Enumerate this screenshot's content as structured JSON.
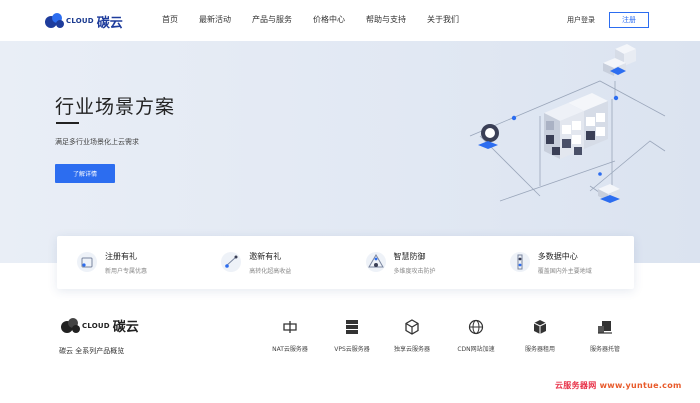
{
  "brand": {
    "logo_en": "CLOUD",
    "logo_cn": "碳云",
    "accent": "#2c6df0",
    "dark": "#1e3c9c"
  },
  "nav": {
    "links": [
      "首页",
      "最新活动",
      "产品与服务",
      "价格中心",
      "帮助与支持",
      "关于我们"
    ],
    "login": "用户登录",
    "register": "注册"
  },
  "hero": {
    "title": "行业场景方案",
    "subtitle": "满足多行业场景化上云需求",
    "button": "了解详情"
  },
  "features": [
    {
      "icon": "gift-icon",
      "title": "注册有礼",
      "desc": "新用户专属优惠"
    },
    {
      "icon": "invite-icon",
      "title": "邀新有礼",
      "desc": "高转化超高收益"
    },
    {
      "icon": "shield-icon",
      "title": "智慧防御",
      "desc": "多维度攻击防护"
    },
    {
      "icon": "datacenter-icon",
      "title": "多数据中心",
      "desc": "覆盖国内外主要地域"
    }
  ],
  "bottom": {
    "caption": "碳云 全系列产品概览",
    "products": [
      {
        "icon": "nat-icon",
        "label": "NAT云服务器"
      },
      {
        "icon": "server-stack-icon",
        "label": "VPS云服务器"
      },
      {
        "icon": "cube-icon",
        "label": "独享云服务器"
      },
      {
        "icon": "globe-icon",
        "label": "CDN网站加速"
      },
      {
        "icon": "box-icon",
        "label": "服务器租用"
      },
      {
        "icon": "hosting-icon",
        "label": "服务器托管"
      }
    ]
  },
  "watermark": {
    "part1": "云服务器网",
    "part2": " www.yuntue.com",
    "color1": "#e8334a",
    "color2": "#e85a2a"
  }
}
